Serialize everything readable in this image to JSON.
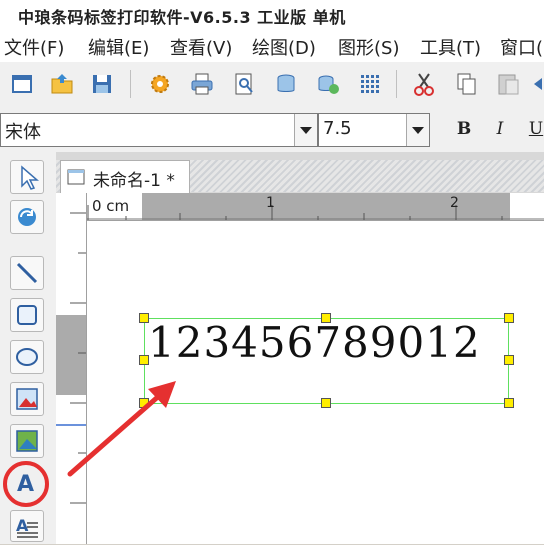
{
  "window": {
    "title": "中琅条码标签打印软件-V6.5.3 工业版 单机"
  },
  "menu": [
    "文件(F)",
    "编辑(E)",
    "查看(V)",
    "绘图(D)",
    "图形(S)",
    "工具(T)",
    "窗口("
  ],
  "font_bar": {
    "font_name": "宋体",
    "font_size": "7.5",
    "bold_label": "B",
    "italic_label": "I",
    "underline_label": "U"
  },
  "document": {
    "tab_title": "未命名-1 *",
    "ruler_unit": "0 cm",
    "ruler_marks": [
      "1",
      "2"
    ]
  },
  "canvas": {
    "text_object_value": "123456789012"
  },
  "icons": {
    "toolbar": [
      "new-icon",
      "open-icon",
      "save-icon",
      "settings-icon",
      "print-icon",
      "print-preview-icon",
      "database-icon",
      "data-import-icon",
      "grid-icon",
      "cut-icon",
      "copy-icon",
      "paste-icon",
      "back-icon"
    ],
    "left_tools": [
      "pointer-icon",
      "rotate-icon",
      "line-icon",
      "rectangle-icon",
      "ellipse-icon",
      "image-icon",
      "picture-icon",
      "text-tool-icon",
      "paragraph-icon"
    ]
  },
  "colors": {
    "selection_border": "#5ee05e",
    "handle_fill": "#ffee00",
    "annotation": "#e53030"
  }
}
